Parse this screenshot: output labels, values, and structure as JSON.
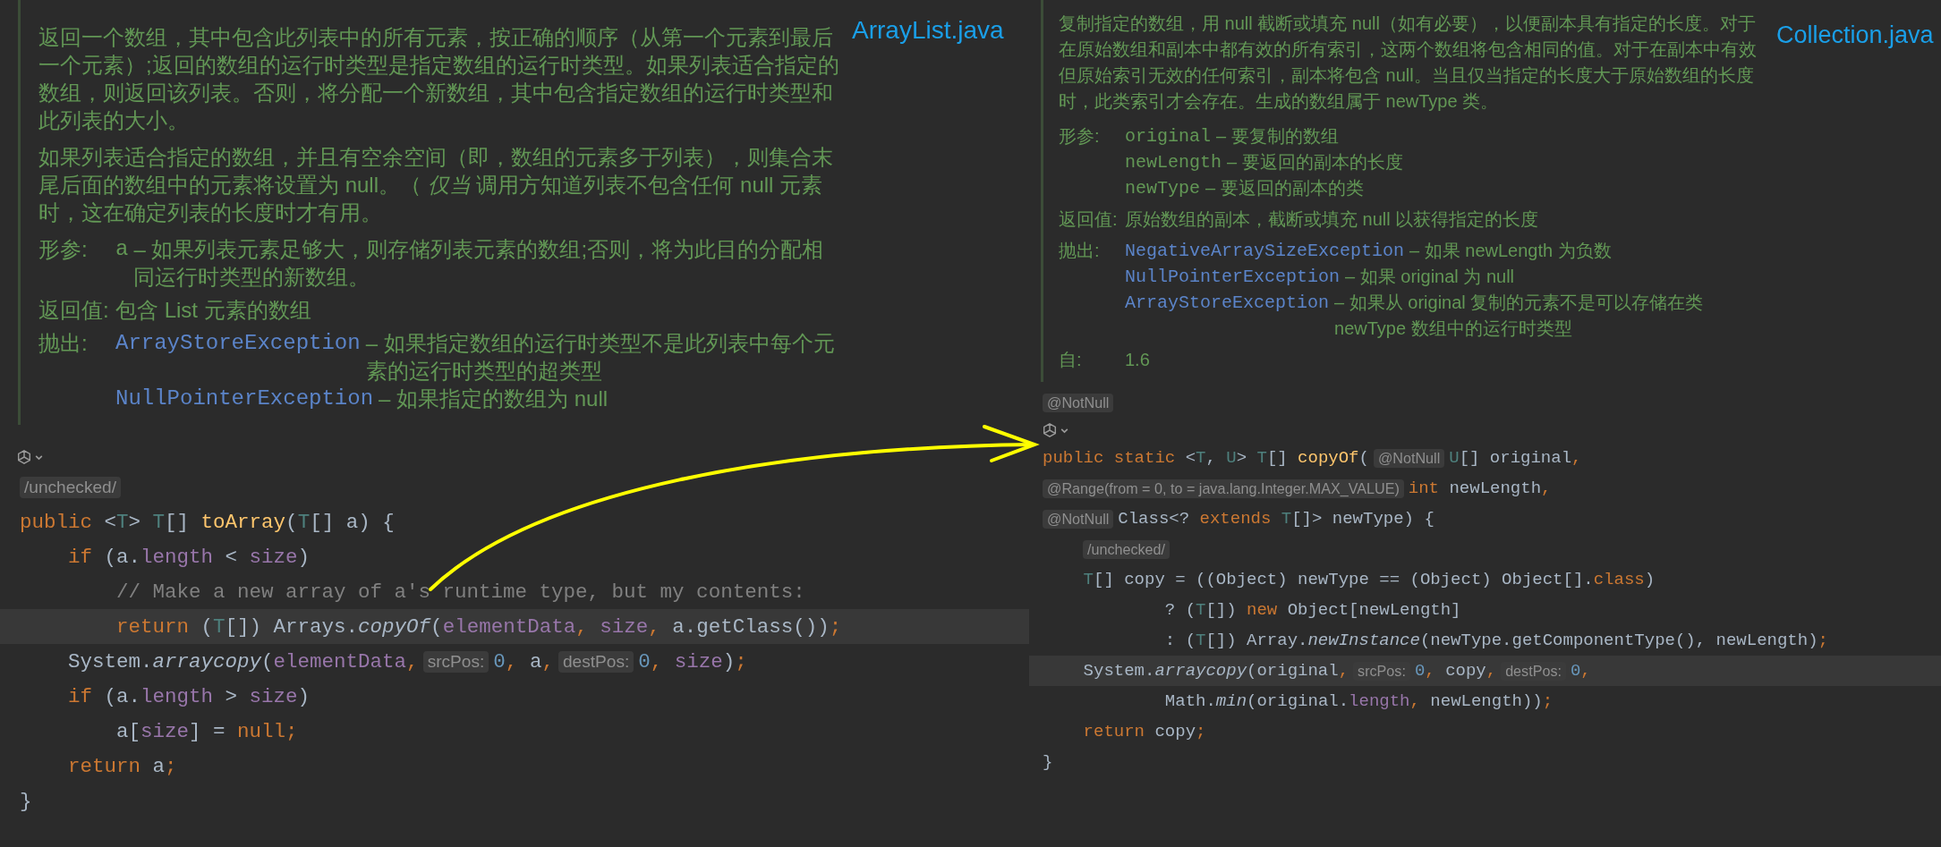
{
  "panels": [
    {
      "file_label": "ArrayList.java",
      "doc": {
        "paragraphs": [
          "返回一个数组，其中包含此列表中的所有元素，按正确的顺序（从第一个元素到最后一个元素）;返回的数组的运行时类型是指定数组的运行时类型。如果列表适合指定的数组，则返回该列表。否则，将分配一个新数组，其中包含指定数组的运行时类型和此列表的大小。",
          "如果列表适合指定的数组，并且有空余空间（即，数组的元素多于列表），则集合末尾后面的数组中的元素将设置为 null。（ *仅当* 调用方知道列表不包含任何 null 元素时，这在确定列表的长度时才有用。"
        ],
        "tags": [
          {
            "label": "形参:",
            "entries": [
              {
                "kind": "param",
                "name": "a",
                "desc": "– 如果列表元素足够大，则存储列表元素的数组;否则，将为此目的分配相同运行时类型的新数组。"
              }
            ]
          },
          {
            "label": "返回值:",
            "entries": [
              {
                "kind": "text",
                "desc": "包含 List 元素的数组"
              }
            ]
          },
          {
            "label": "抛出:",
            "entries": [
              {
                "kind": "exception",
                "name": "ArrayStoreException",
                "desc": "– 如果指定数组的运行时类型不是此列表中每个元素的运行时类型的超类型"
              },
              {
                "kind": "exception",
                "name": "NullPointerException",
                "desc": "– 如果指定的数组为 null"
              }
            ]
          }
        ]
      },
      "code": [
        {
          "kind": "icon"
        },
        {
          "kind": "code",
          "current": false,
          "segments": [
            {
              "kind": "hint",
              "text": "/unchecked/"
            }
          ]
        },
        {
          "kind": "code",
          "current": false,
          "segments": [
            {
              "kind": "code",
              "tokens": [
                {
                  "kind": "kw",
                  "text": "public"
                },
                {
                  "kind": "p",
                  "text": " <"
                },
                {
                  "kind": "tp",
                  "text": "T"
                },
                {
                  "kind": "p",
                  "text": "> "
                },
                {
                  "kind": "tp",
                  "text": "T"
                },
                {
                  "kind": "p",
                  "text": "[] "
                },
                {
                  "kind": "decl",
                  "text": "toArray"
                },
                {
                  "kind": "p",
                  "text": "("
                },
                {
                  "kind": "tp",
                  "text": "T"
                },
                {
                  "kind": "p",
                  "text": "[] a) {"
                }
              ]
            }
          ]
        },
        {
          "kind": "code",
          "current": false,
          "segments": [
            {
              "kind": "code",
              "tokens": [
                {
                  "kind": "kw",
                  "text": "    if"
                },
                {
                  "kind": "p",
                  "text": " (a."
                },
                {
                  "kind": "fld",
                  "text": "length"
                },
                {
                  "kind": "p",
                  "text": " < "
                },
                {
                  "kind": "fld",
                  "text": "size"
                },
                {
                  "kind": "p",
                  "text": ")"
                }
              ]
            }
          ]
        },
        {
          "kind": "code",
          "current": false,
          "segments": [
            {
              "kind": "code",
              "tokens": [
                {
                  "kind": "cm",
                  "text": "        // Make a new array of a's runtime type, but my contents:"
                }
              ]
            }
          ]
        },
        {
          "kind": "code",
          "current": true,
          "segments": [
            {
              "kind": "code",
              "tokens": [
                {
                  "kind": "kw",
                  "text": "        return"
                },
                {
                  "kind": "p",
                  "text": " ("
                },
                {
                  "kind": "tp",
                  "text": "T"
                },
                {
                  "kind": "p",
                  "text": "[]) Arrays."
                },
                {
                  "kind": "it",
                  "text": "copyOf"
                },
                {
                  "kind": "p",
                  "text": "("
                },
                {
                  "kind": "fld",
                  "text": "elementData"
                },
                {
                  "kind": "kw",
                  "text": ", "
                },
                {
                  "kind": "fld",
                  "text": "size"
                },
                {
                  "kind": "kw",
                  "text": ", "
                },
                {
                  "kind": "p",
                  "text": "a.getClass())"
                },
                {
                  "kind": "kw",
                  "text": ";"
                }
              ]
            }
          ]
        },
        {
          "kind": "code",
          "current": false,
          "segments": [
            {
              "kind": "code",
              "tokens": [
                {
                  "kind": "p",
                  "text": "    System."
                },
                {
                  "kind": "it",
                  "text": "arraycopy"
                },
                {
                  "kind": "p",
                  "text": "("
                },
                {
                  "kind": "fld",
                  "text": "elementData"
                },
                {
                  "kind": "kw",
                  "text": ","
                }
              ]
            },
            {
              "kind": "hint",
              "text": "srcPos:"
            },
            {
              "kind": "code",
              "tokens": [
                {
                  "kind": "num",
                  "text": "0"
                },
                {
                  "kind": "kw",
                  "text": ", "
                },
                {
                  "kind": "p",
                  "text": "a"
                },
                {
                  "kind": "kw",
                  "text": ","
                }
              ]
            },
            {
              "kind": "hint",
              "text": "destPos:"
            },
            {
              "kind": "code",
              "tokens": [
                {
                  "kind": "num",
                  "text": "0"
                },
                {
                  "kind": "kw",
                  "text": ", "
                },
                {
                  "kind": "fld",
                  "text": "size"
                },
                {
                  "kind": "p",
                  "text": ")"
                },
                {
                  "kind": "kw",
                  "text": ";"
                }
              ]
            }
          ]
        },
        {
          "kind": "code",
          "current": false,
          "segments": [
            {
              "kind": "code",
              "tokens": [
                {
                  "kind": "kw",
                  "text": "    if"
                },
                {
                  "kind": "p",
                  "text": " (a."
                },
                {
                  "kind": "fld",
                  "text": "length"
                },
                {
                  "kind": "p",
                  "text": " > "
                },
                {
                  "kind": "fld",
                  "text": "size"
                },
                {
                  "kind": "p",
                  "text": ")"
                }
              ]
            }
          ]
        },
        {
          "kind": "code",
          "current": false,
          "segments": [
            {
              "kind": "code",
              "tokens": [
                {
                  "kind": "p",
                  "text": "        a["
                },
                {
                  "kind": "fld",
                  "text": "size"
                },
                {
                  "kind": "p",
                  "text": "] = "
                },
                {
                  "kind": "kw",
                  "text": "null;"
                }
              ]
            }
          ]
        },
        {
          "kind": "code",
          "current": false,
          "segments": [
            {
              "kind": "code",
              "tokens": [
                {
                  "kind": "kw",
                  "text": "    return"
                },
                {
                  "kind": "p",
                  "text": " a"
                },
                {
                  "kind": "kw",
                  "text": ";"
                }
              ]
            }
          ]
        },
        {
          "kind": "code",
          "current": false,
          "segments": [
            {
              "kind": "code",
              "tokens": [
                {
                  "kind": "p",
                  "text": "}"
                }
              ]
            }
          ]
        }
      ]
    },
    {
      "file_label": "Collection.java",
      "doc": {
        "paragraphs": [
          "复制指定的数组，用 null 截断或填充 null（如有必要），以便副本具有指定的长度。对于在原始数组和副本中都有效的所有索引，这两个数组将包含相同的值。对于在副本中有效但原始索引无效的任何索引，副本将包含 null。当且仅当指定的长度大于原始数组的长度时，此类索引才会存在。生成的数组属于 newType 类。"
        ],
        "tags": [
          {
            "label": "形参:",
            "entries": [
              {
                "kind": "param",
                "name": "original",
                "desc": "– 要复制的数组"
              },
              {
                "kind": "param",
                "name": "newLength",
                "desc": "– 要返回的副本的长度"
              },
              {
                "kind": "param",
                "name": "newType",
                "desc": "– 要返回的副本的类"
              }
            ]
          },
          {
            "label": "返回值:",
            "entries": [
              {
                "kind": "text",
                "desc": "原始数组的副本，截断或填充 null 以获得指定的长度"
              }
            ]
          },
          {
            "label": "抛出:",
            "entries": [
              {
                "kind": "exception",
                "name": "NegativeArraySizeException",
                "desc": "– 如果 newLength 为负数"
              },
              {
                "kind": "exception",
                "name": "NullPointerException",
                "desc": "– 如果 original 为 null"
              },
              {
                "kind": "exception",
                "name": "ArrayStoreException",
                "desc": "– 如果从 original 复制的元素不是可以存储在类 newType 数组中的运行时类型"
              }
            ]
          },
          {
            "label": "自:",
            "entries": [
              {
                "kind": "text",
                "desc": "1.6"
              }
            ]
          }
        ]
      },
      "code": [
        {
          "kind": "code",
          "current": false,
          "segments": [
            {
              "kind": "hint",
              "text": "@NotNull"
            }
          ]
        },
        {
          "kind": "icon"
        },
        {
          "kind": "code",
          "current": false,
          "segments": [
            {
              "kind": "code",
              "tokens": [
                {
                  "kind": "kw",
                  "text": "public static"
                },
                {
                  "kind": "p",
                  "text": " <"
                },
                {
                  "kind": "tp",
                  "text": "T"
                },
                {
                  "kind": "p",
                  "text": ", "
                },
                {
                  "kind": "tp",
                  "text": "U"
                },
                {
                  "kind": "p",
                  "text": "> "
                },
                {
                  "kind": "tp",
                  "text": "T"
                },
                {
                  "kind": "p",
                  "text": "[] "
                },
                {
                  "kind": "decl",
                  "text": "copyOf"
                },
                {
                  "kind": "p",
                  "text": "("
                }
              ]
            },
            {
              "kind": "hint",
              "text": "@NotNull"
            },
            {
              "kind": "code",
              "tokens": [
                {
                  "kind": "tp",
                  "text": "U"
                },
                {
                  "kind": "p",
                  "text": "[] original"
                },
                {
                  "kind": "kw",
                  "text": ","
                }
              ]
            }
          ]
        },
        {
          "kind": "code",
          "current": false,
          "segments": [
            {
              "kind": "hint",
              "text": "@Range(from = 0, to = java.lang.Integer.MAX_VALUE)"
            },
            {
              "kind": "code",
              "tokens": [
                {
                  "kind": "kw",
                  "text": "int"
                },
                {
                  "kind": "p",
                  "text": " newLength"
                },
                {
                  "kind": "kw",
                  "text": ","
                }
              ]
            }
          ]
        },
        {
          "kind": "code",
          "current": false,
          "segments": [
            {
              "kind": "hint",
              "text": "@NotNull"
            },
            {
              "kind": "code",
              "tokens": [
                {
                  "kind": "p",
                  "text": "Class<? "
                },
                {
                  "kind": "kw",
                  "text": "extends"
                },
                {
                  "kind": "tp",
                  "text": " T"
                },
                {
                  "kind": "p",
                  "text": "[]> newType) {"
                }
              ]
            }
          ]
        },
        {
          "kind": "code",
          "current": false,
          "indented": true,
          "segments": [
            {
              "kind": "hint",
              "text": "/unchecked/"
            }
          ]
        },
        {
          "kind": "code",
          "current": false,
          "segments": [
            {
              "kind": "code",
              "tokens": [
                {
                  "kind": "tp",
                  "text": "    T"
                },
                {
                  "kind": "p",
                  "text": "[] copy = ((Object) newType == (Object) Object[]."
                },
                {
                  "kind": "kw",
                  "text": "class"
                },
                {
                  "kind": "p",
                  "text": ")"
                }
              ]
            }
          ]
        },
        {
          "kind": "code",
          "current": false,
          "segments": [
            {
              "kind": "code",
              "tokens": [
                {
                  "kind": "p",
                  "text": "            ? ("
                },
                {
                  "kind": "tp",
                  "text": "T"
                },
                {
                  "kind": "p",
                  "text": "[]) "
                },
                {
                  "kind": "kw",
                  "text": "new"
                },
                {
                  "kind": "p",
                  "text": " Object[newLength]"
                }
              ]
            }
          ]
        },
        {
          "kind": "code",
          "current": false,
          "segments": [
            {
              "kind": "code",
              "tokens": [
                {
                  "kind": "p",
                  "text": "            : ("
                },
                {
                  "kind": "tp",
                  "text": "T"
                },
                {
                  "kind": "p",
                  "text": "[]) Array."
                },
                {
                  "kind": "it",
                  "text": "newInstance"
                },
                {
                  "kind": "p",
                  "text": "(newType.getComponentType(), newLength)"
                },
                {
                  "kind": "kw",
                  "text": ";"
                }
              ]
            }
          ]
        },
        {
          "kind": "code",
          "current": true,
          "segments": [
            {
              "kind": "code",
              "tokens": [
                {
                  "kind": "p",
                  "text": "    System."
                },
                {
                  "kind": "it",
                  "text": "arraycopy"
                },
                {
                  "kind": "p",
                  "text": "(original"
                },
                {
                  "kind": "kw",
                  "text": ","
                }
              ]
            },
            {
              "kind": "hint",
              "text": "srcPos:"
            },
            {
              "kind": "code",
              "tokens": [
                {
                  "kind": "num",
                  "text": "0"
                },
                {
                  "kind": "kw",
                  "text": ", "
                },
                {
                  "kind": "p",
                  "text": "copy"
                },
                {
                  "kind": "kw",
                  "text": ","
                }
              ]
            },
            {
              "kind": "hint",
              "text": "destPos:"
            },
            {
              "kind": "code",
              "tokens": [
                {
                  "kind": "num",
                  "text": "0"
                },
                {
                  "kind": "kw",
                  "text": ","
                }
              ]
            }
          ]
        },
        {
          "kind": "code",
          "current": false,
          "segments": [
            {
              "kind": "code",
              "tokens": [
                {
                  "kind": "p",
                  "text": "            Math."
                },
                {
                  "kind": "it",
                  "text": "min"
                },
                {
                  "kind": "p",
                  "text": "(original."
                },
                {
                  "kind": "fld",
                  "text": "length"
                },
                {
                  "kind": "kw",
                  "text": ", "
                },
                {
                  "kind": "p",
                  "text": "newLength))"
                },
                {
                  "kind": "kw",
                  "text": ";"
                }
              ]
            }
          ]
        },
        {
          "kind": "code",
          "current": false,
          "segments": [
            {
              "kind": "code",
              "tokens": [
                {
                  "kind": "kw",
                  "text": "    return"
                },
                {
                  "kind": "p",
                  "text": " copy"
                },
                {
                  "kind": "kw",
                  "text": ";"
                }
              ]
            }
          ]
        },
        {
          "kind": "code",
          "current": false,
          "segments": [
            {
              "kind": "code",
              "tokens": [
                {
                  "kind": "p",
                  "text": "}"
                }
              ]
            }
          ]
        }
      ]
    }
  ]
}
